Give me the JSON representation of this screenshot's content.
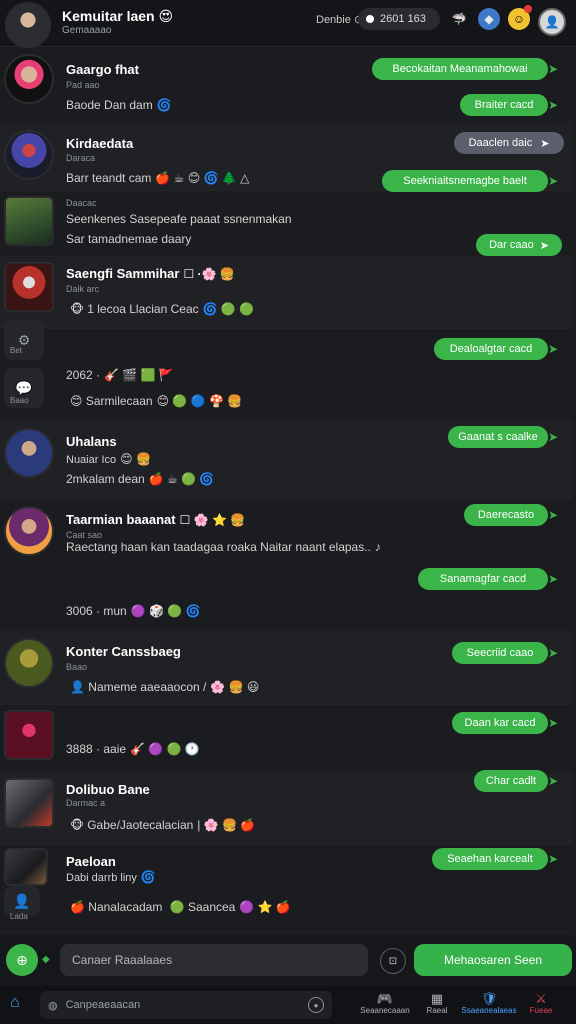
{
  "header": {
    "title": "Kemuitar laen 😍",
    "subtitle": "Gemaaaao",
    "status_text": "Denbie ⊙",
    "pill_text": "2601 163",
    "icons": [
      "shark-icon",
      "blue-orb-icon",
      "smiley-icon",
      "profile-avatar-icon"
    ]
  },
  "rows": [
    {
      "name": "Gaargo fhat",
      "meta": "Pad aao",
      "line": "Baode Dan dam",
      "bubbles": [
        "Becokaitan Meanamahowai",
        "Braiter cacd"
      ]
    },
    {
      "name": "Kirdaedata",
      "meta": "Daraca",
      "line": "Barr teandt cam",
      "bubbles": [
        "Daaclen daic",
        "Seekniaitsnemagbe baelt"
      ]
    },
    {
      "name": "",
      "meta": "Daacac",
      "line": "Seenkenes Sasepeafe paaat ssnenmakan",
      "line2": "Sar tamadnemae daary",
      "bubbles": [
        "Dar caao"
      ]
    },
    {
      "name": "Saengfi Sammihar",
      "meta": "Dalk arc",
      "line": "1 lecoa  Llacian  Ceac",
      "bubbles": []
    },
    {
      "name": "",
      "meta": "",
      "line": "2062 ·",
      "line2": "Sarmilecaan",
      "bubbles": [
        "Dealoalgtar cacd"
      ],
      "side_icons": [
        {
          "name": "games-icon",
          "label": "Bet"
        },
        {
          "name": "chat-icon",
          "label": "Baao"
        }
      ]
    },
    {
      "name": "Uhalans",
      "meta": "Nuaiar  Ico",
      "line": "2mkalam dean",
      "bubbles": [
        "Gaanat s caalke"
      ]
    },
    {
      "name": "Taarmian baaanat",
      "meta": "Caat sao",
      "line": "Raectang haan kan taadagaa roaka Naitar naant elapas..",
      "line2": "3006 ·  mun",
      "bubbles": [
        "Daerecasto",
        "Sanamagfar cacd"
      ]
    },
    {
      "name": "Konter Canssbaeg",
      "meta": "Baao",
      "line": "Nameme aaeaaocon  /",
      "bubbles": [
        "Seecriid caao"
      ]
    },
    {
      "name": "",
      "meta": "",
      "line": "3888 ·  aaie",
      "bubbles": [
        "Daan kar cacd"
      ]
    },
    {
      "name": "Dolibuo Bane",
      "meta": "Darmac a",
      "line": "Gabe/Jaotecalacian",
      "bubbles": [
        "Char cadlt"
      ]
    },
    {
      "name": "Paeloan",
      "meta": "Dabi darrb liny",
      "line": "Nanalacadam",
      "line_tail": "Saancea",
      "bubbles": [
        "Seaehan karcealt"
      ],
      "side_icons": [
        {
          "name": "avatar-small-icon",
          "label": "Lada"
        }
      ]
    }
  ],
  "composer": {
    "placeholder": "Canaer Raaalaaes",
    "send_label": "Mehaosaren  Seen"
  },
  "bottom": {
    "search_placeholder": "Canpeaeaacan",
    "nav": [
      {
        "label": "Seaanecaaan",
        "icon": "controller-icon"
      },
      {
        "label": "Raeal",
        "icon": "grid-icon"
      },
      {
        "label": "Ssaeanealaeas",
        "icon": "shield-icon"
      },
      {
        "label": "Fueae",
        "icon": "sword-icon"
      }
    ]
  },
  "colors": {
    "accent_green": "#3bb54a",
    "gray_bubble": "#5a5f6b",
    "bg": "#1b1c1f"
  }
}
